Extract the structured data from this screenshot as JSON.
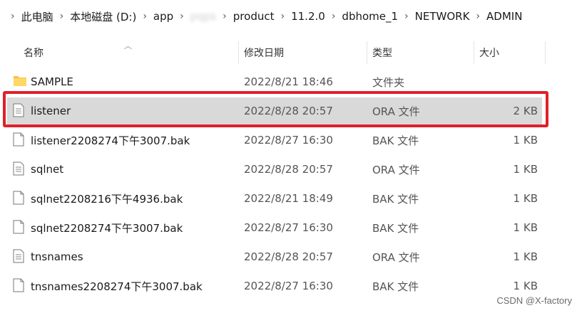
{
  "breadcrumb": {
    "items": [
      "此电脑",
      "本地磁盘 (D:)",
      "app",
      "pqps",
      "product",
      "11.2.0",
      "dbhome_1",
      "NETWORK",
      "ADMIN"
    ]
  },
  "columns": {
    "name": "名称",
    "date": "修改日期",
    "type": "类型",
    "size": "大小"
  },
  "files": [
    {
      "name": "SAMPLE",
      "date": "2022/8/21 18:46",
      "type": "文件夹",
      "size": "",
      "icon": "folder-icon",
      "selected": false
    },
    {
      "name": "listener",
      "date": "2022/8/28 20:57",
      "type": "ORA 文件",
      "size": "2 KB",
      "icon": "text-file-icon",
      "selected": true
    },
    {
      "name": "listener2208274下午3007.bak",
      "date": "2022/8/27 16:30",
      "type": "BAK 文件",
      "size": "1 KB",
      "icon": "blank-file-icon",
      "selected": false
    },
    {
      "name": "sqlnet",
      "date": "2022/8/28 20:57",
      "type": "ORA 文件",
      "size": "1 KB",
      "icon": "text-file-icon",
      "selected": false
    },
    {
      "name": "sqlnet2208216下午4936.bak",
      "date": "2022/8/21 18:49",
      "type": "BAK 文件",
      "size": "1 KB",
      "icon": "blank-file-icon",
      "selected": false
    },
    {
      "name": "sqlnet2208274下午3007.bak",
      "date": "2022/8/27 16:30",
      "type": "BAK 文件",
      "size": "1 KB",
      "icon": "blank-file-icon",
      "selected": false
    },
    {
      "name": "tnsnames",
      "date": "2022/8/28 20:57",
      "type": "ORA 文件",
      "size": "1 KB",
      "icon": "text-file-icon",
      "selected": false
    },
    {
      "name": "tnsnames2208274下午3007.bak",
      "date": "2022/8/27 16:30",
      "type": "BAK 文件",
      "size": "1 KB",
      "icon": "blank-file-icon",
      "selected": false
    }
  ],
  "watermark": "CSDN @X-factory",
  "colors": {
    "selected_row": "#d9d9d9",
    "highlight_border": "#e0202a",
    "folder": "#f5c342"
  }
}
